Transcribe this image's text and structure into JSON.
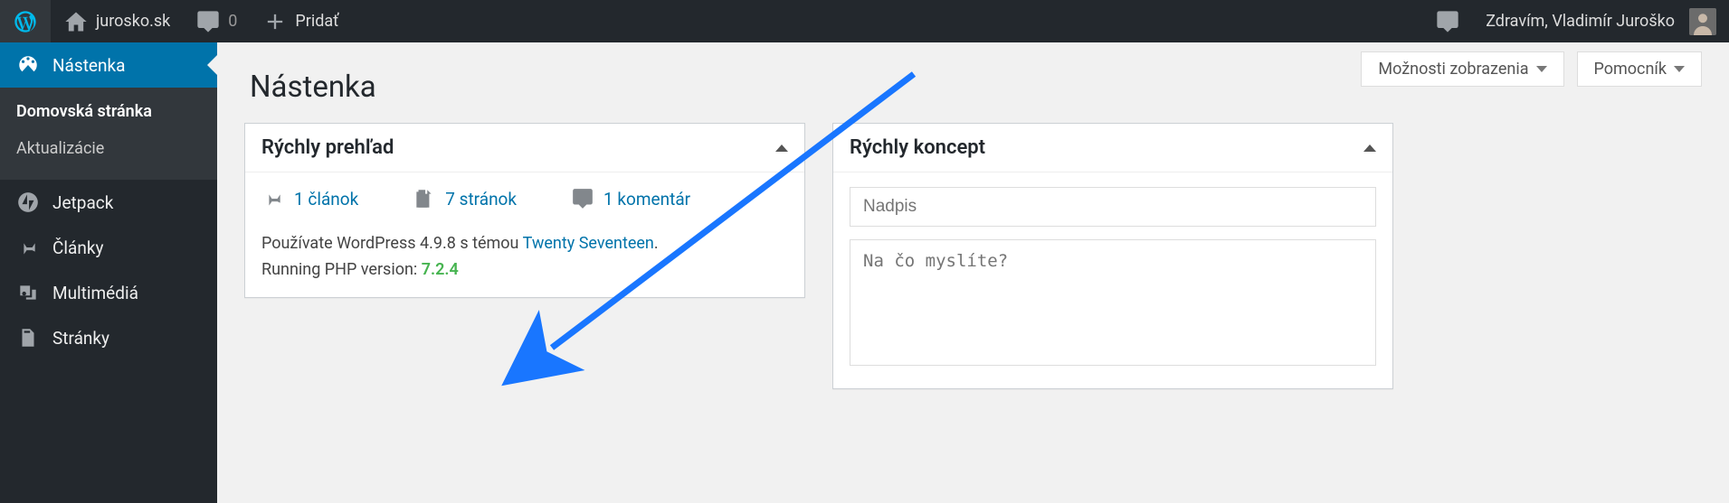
{
  "adminbar": {
    "site_name": "jurosko.sk",
    "comments_count": "0",
    "add_new_label": "Pridať",
    "greeting": "Zdravím, Vladimír Juroško"
  },
  "sidebar": {
    "dashboard": "Nástenka",
    "home": "Domovská stránka",
    "updates": "Aktualizácie",
    "jetpack": "Jetpack",
    "posts": "Články",
    "media": "Multimédiá",
    "pages": "Stránky"
  },
  "screen_opts": {
    "options": "Možnosti zobrazenia",
    "help": "Pomocník"
  },
  "page_title": "Nástenka",
  "glance": {
    "heading": "Rýchly prehľad",
    "posts": "1 článok",
    "pages": "7 stránok",
    "comments": "1 komentár",
    "version_pre": "Používate WordPress 4.9.8 s témou ",
    "theme": "Twenty Seventeen",
    "version_post": ".",
    "php_pre": "Running PHP version: ",
    "php_ver": "7.2.4"
  },
  "quickdraft": {
    "heading": "Rýchly koncept",
    "title_placeholder": "Nadpis",
    "content_placeholder": "Na čo myslíte?"
  }
}
